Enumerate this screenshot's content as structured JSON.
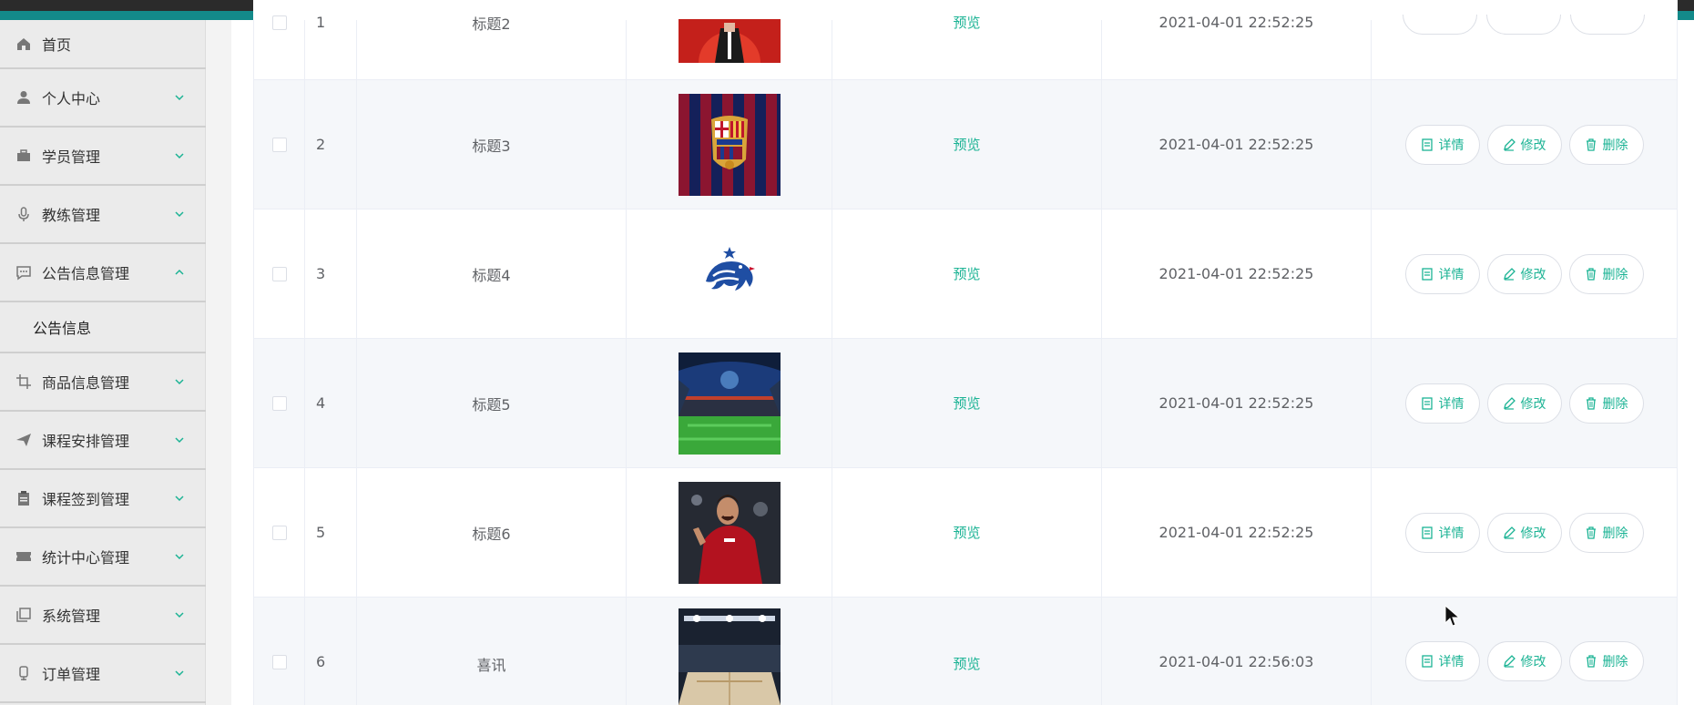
{
  "sidebar": {
    "items": [
      {
        "label": "首页",
        "icon": "home-icon",
        "expanded": null
      },
      {
        "label": "个人中心",
        "icon": "user-icon",
        "expanded": false
      },
      {
        "label": "学员管理",
        "icon": "briefcase-icon",
        "expanded": false
      },
      {
        "label": "教练管理",
        "icon": "microphone-icon",
        "expanded": false
      },
      {
        "label": "公告信息管理",
        "icon": "chat-icon",
        "expanded": true
      },
      {
        "label": "商品信息管理",
        "icon": "crop-icon",
        "expanded": false
      },
      {
        "label": "课程安排管理",
        "icon": "send-icon",
        "expanded": false
      },
      {
        "label": "课程签到管理",
        "icon": "clipboard-icon",
        "expanded": false
      },
      {
        "label": "统计中心管理",
        "icon": "ticket-icon",
        "expanded": false
      },
      {
        "label": "系统管理",
        "icon": "copy-icon",
        "expanded": false
      },
      {
        "label": "订单管理",
        "icon": "bookmark-icon",
        "expanded": false
      }
    ],
    "submenu": {
      "label": "公告信息"
    }
  },
  "table": {
    "preview_label": "预览",
    "actions": {
      "detail": "详情",
      "edit": "修改",
      "delete": "删除"
    },
    "rows": [
      {
        "index": "1",
        "title": "标题2",
        "time": "2021-04-01 22:52:25",
        "image": "performer-red"
      },
      {
        "index": "2",
        "title": "标题3",
        "time": "2021-04-01 22:52:25",
        "image": "fcb-crest"
      },
      {
        "index": "3",
        "title": "标题4",
        "time": "2021-04-01 22:52:25",
        "image": "rooster-logo"
      },
      {
        "index": "4",
        "title": "标题5",
        "time": "2021-04-01 22:52:25",
        "image": "stadium-green"
      },
      {
        "index": "5",
        "title": "标题6",
        "time": "2021-04-01 22:52:25",
        "image": "player-red"
      },
      {
        "index": "6",
        "title": "喜讯",
        "time": "2021-04-01 22:56:03",
        "image": "arena-lights"
      }
    ]
  },
  "colors": {
    "accent": "#1bb394",
    "topbar": "#138a8a"
  }
}
